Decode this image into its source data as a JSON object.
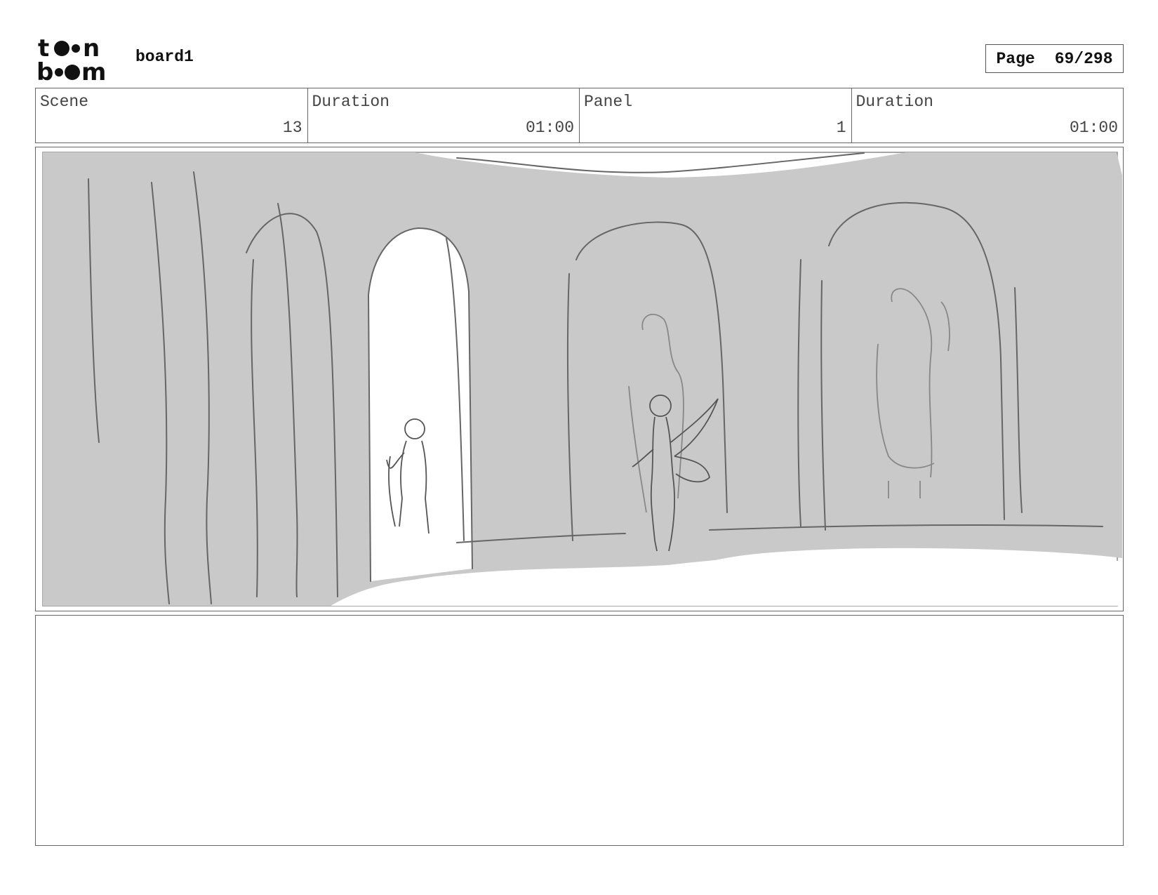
{
  "header": {
    "logo_text": "toon boom",
    "board_name": "board1",
    "page_label": "Page",
    "page_value": "69/298"
  },
  "info": [
    {
      "label": "Scene",
      "value": "13"
    },
    {
      "label": "Duration",
      "value": "01:00"
    },
    {
      "label": "Panel",
      "value": "1"
    },
    {
      "label": "Duration",
      "value": "01:00"
    }
  ],
  "notes": {
    "text": ""
  },
  "colors": {
    "wall_grey": "#c8c8c8",
    "line_dark": "#555555",
    "border": "#666666"
  }
}
